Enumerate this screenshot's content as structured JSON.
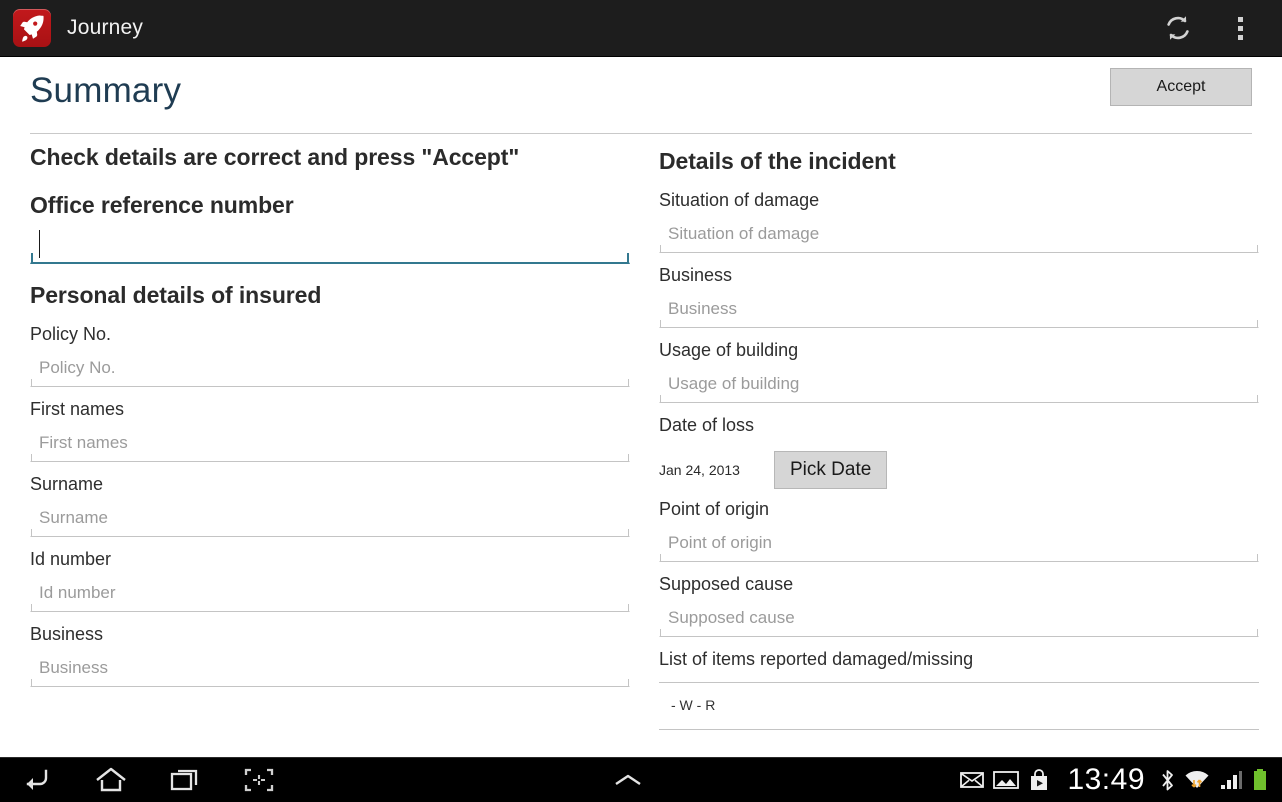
{
  "actionbar": {
    "app_name": "Journey",
    "app_icon": "rocket-icon",
    "refresh_icon": "refresh-icon",
    "overflow_icon": "overflow-menu-icon",
    "background": "#1d1d1d"
  },
  "header": {
    "title": "Summary",
    "title_color": "#1f3c52",
    "accept_label": "Accept"
  },
  "left_column": {
    "instruction": "Check details are correct and press \"Accept\"",
    "office_ref_heading": "Office reference number",
    "office_ref_value": "",
    "office_ref_focused": true,
    "focus_color": "#33788f",
    "personal_heading": "Personal details of insured",
    "fields": [
      {
        "label": "Policy No.",
        "placeholder": "Policy No.",
        "value": ""
      },
      {
        "label": "First names",
        "placeholder": "First names",
        "value": ""
      },
      {
        "label": "Surname",
        "placeholder": "Surname",
        "value": ""
      },
      {
        "label": "Id number",
        "placeholder": "Id number",
        "value": ""
      },
      {
        "label": "Business",
        "placeholder": "Business",
        "value": ""
      }
    ]
  },
  "right_column": {
    "heading": "Details of the incident",
    "fields_top": [
      {
        "label": "Situation of damage",
        "placeholder": "Situation of damage",
        "value": ""
      },
      {
        "label": "Business",
        "placeholder": "Business",
        "value": ""
      },
      {
        "label": "Usage of building",
        "placeholder": "Usage of building",
        "value": ""
      }
    ],
    "date_label": "Date of loss",
    "date_value": "Jan 24, 2013",
    "pick_date_label": "Pick Date",
    "fields_bottom": [
      {
        "label": "Point of origin",
        "placeholder": "Point of origin",
        "value": ""
      },
      {
        "label": "Supposed cause",
        "placeholder": "Supposed cause",
        "value": ""
      }
    ],
    "list_label": "List of items reported damaged/missing",
    "list_items": [
      "- W - R"
    ]
  },
  "system_bar": {
    "back_icon": "back-icon",
    "home_icon": "home-icon",
    "recents_icon": "recent-apps-icon",
    "screenshot_icon": "screenshot-icon",
    "expand_icon": "chevron-up-icon",
    "status_icons": [
      "email-icon",
      "gallery-icon",
      "play-store-icon"
    ],
    "clock": "13:49",
    "right_icons": [
      "bluetooth-icon",
      "wifi-icon",
      "signal-icon",
      "battery-icon"
    ],
    "battery_color": "#6fc02c"
  }
}
